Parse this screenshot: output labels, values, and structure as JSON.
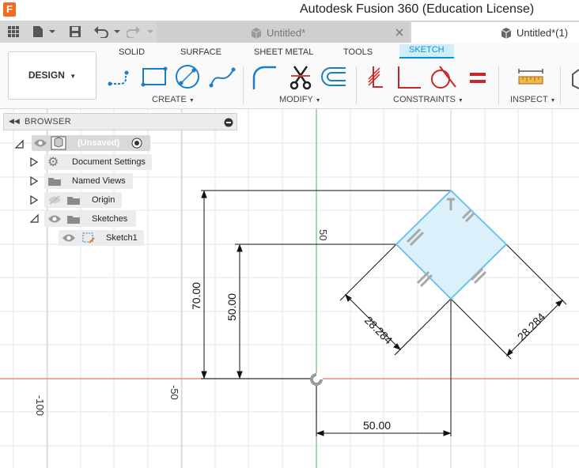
{
  "titlebar": {
    "logo_letter": "F",
    "title": "Autodesk Fusion 360 (Education License)"
  },
  "tabs": [
    {
      "label": "Untitled*",
      "active": false
    },
    {
      "label": "Untitled*(1)",
      "active": true
    }
  ],
  "ribbon": {
    "workspace": "DESIGN",
    "tabs": [
      "SOLID",
      "SURFACE",
      "SHEET METAL",
      "TOOLS",
      "SKETCH"
    ],
    "active_tab": "SKETCH",
    "groups": [
      "CREATE",
      "MODIFY",
      "CONSTRAINTS",
      "INSPECT"
    ],
    "accent": "#0696d7"
  },
  "browser": {
    "title": "BROWSER",
    "items": [
      {
        "label": "(Unsaved)"
      },
      {
        "label": "Document Settings"
      },
      {
        "label": "Named Views"
      },
      {
        "label": "Origin"
      },
      {
        "label": "Sketches"
      },
      {
        "label": "Sketch1"
      }
    ]
  },
  "canvas": {
    "axis_labels": [
      "-100",
      "-50",
      "50"
    ],
    "dimensions": {
      "height_outer": "70.00",
      "height_inner": "50.00",
      "diagonal_left": "28.284",
      "diagonal_right": "28.284",
      "horizontal": "50.00"
    },
    "colors": {
      "x_axis": "#e06666",
      "y_axis": "#6cc56c",
      "sketch_line": "#6ec3ea",
      "sketch_fill": "#dcf0fb",
      "grid": "#e2e2e2"
    }
  }
}
